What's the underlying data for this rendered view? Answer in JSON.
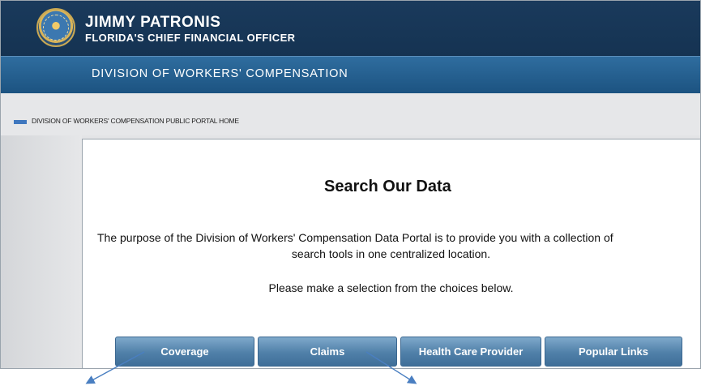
{
  "header": {
    "name": "JIMMY PATRONIS",
    "title": "FLORIDA'S CHIEF FINANCIAL OFFICER",
    "seal_icon": "florida-cfo-seal-icon"
  },
  "division_bar": {
    "title": "DIVISION OF WORKERS' COMPENSATION"
  },
  "breadcrumb": {
    "link_label": "DIVISION OF WORKERS' COMPENSATION PUBLIC PORTAL HOME"
  },
  "main": {
    "heading": "Search Our Data",
    "purpose_line_1": "The purpose of the Division of Workers' Compensation Data Portal is to provide you with a collection of",
    "purpose_line_2": "search tools in one centralized location.",
    "instruction": "Please make a selection from the choices below.",
    "buttons": [
      {
        "label": "Coverage"
      },
      {
        "label": "Claims"
      },
      {
        "label": "Health Care Provider"
      },
      {
        "label": "Popular Links"
      }
    ]
  },
  "colors": {
    "header_bg": "#153352",
    "division_bar_bg": "#1c5381",
    "button_bg": "#4f7fa8",
    "annotation_arrow": "#4a7fc1"
  }
}
